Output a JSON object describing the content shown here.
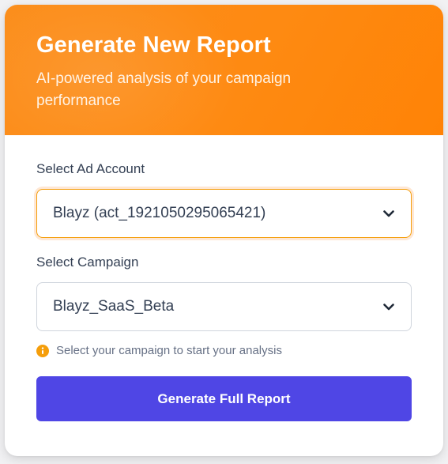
{
  "header": {
    "title": "Generate New Report",
    "subtitle": "AI-powered analysis of your campaign performance"
  },
  "ad_account": {
    "label": "Select Ad Account",
    "selected": "Blayz (act_1921050295065421)",
    "icon": "chevron-down-icon"
  },
  "campaign": {
    "label": "Select Campaign",
    "selected": "Blayz_SaaS_Beta",
    "icon": "chevron-down-icon"
  },
  "hint": {
    "text": "Select your campaign to start your analysis",
    "icon": "info-icon"
  },
  "actions": {
    "generate_label": "Generate Full Report"
  },
  "colors": {
    "header_start": "#fb8d1a",
    "header_end": "#ff8306",
    "button": "#4f46e5",
    "focus_border": "#f59e0b",
    "info": "#f59e0b"
  }
}
